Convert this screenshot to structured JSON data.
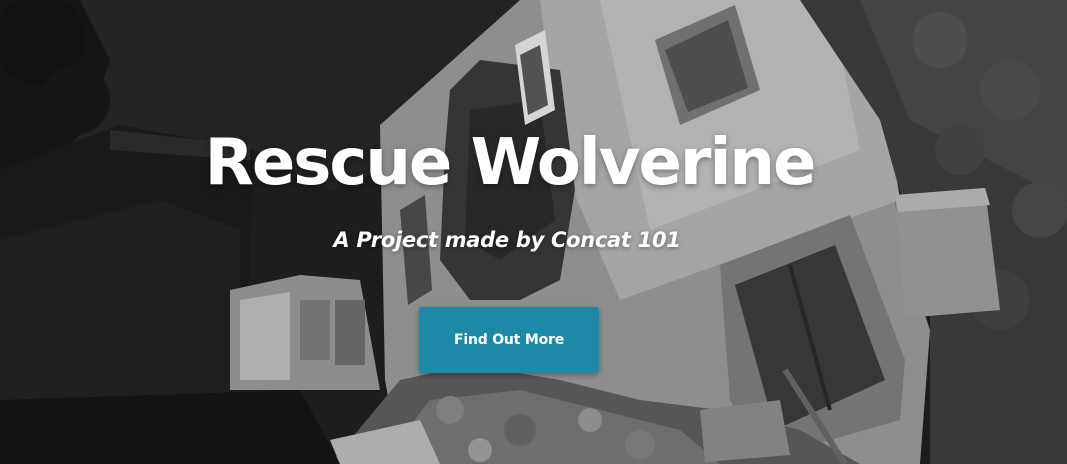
{
  "hero": {
    "title": "Rescue Wolverine",
    "subtitle": "A Project made by Concat 101",
    "cta_label": "Find Out More"
  },
  "colors": {
    "button_background": "#1c8aa6",
    "text": "#ffffff",
    "photo_tone": "grayscale"
  }
}
